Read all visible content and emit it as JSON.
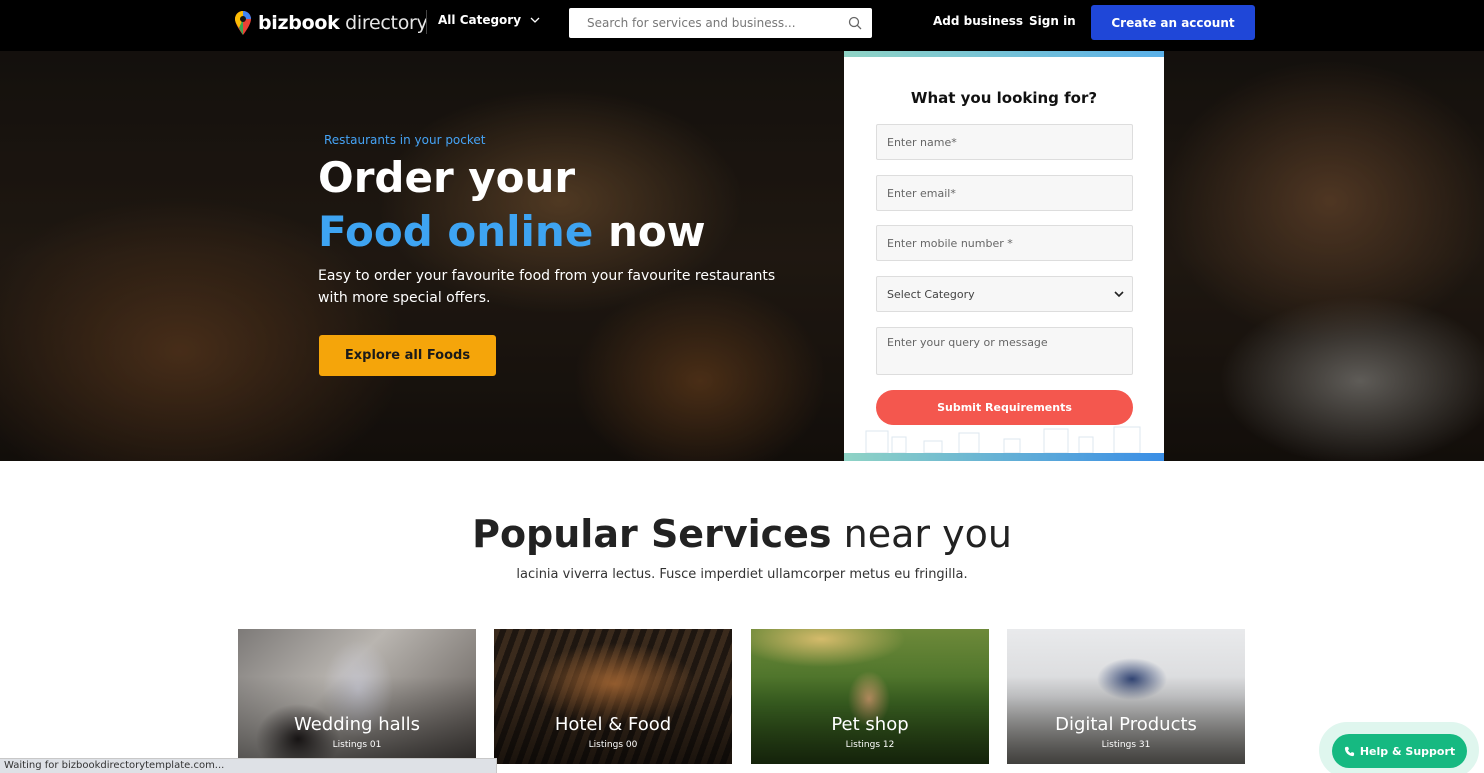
{
  "header": {
    "logo_bold": "bizbook",
    "logo_light": "directory",
    "category_label": "All Category",
    "search_placeholder": "Search for services and business...",
    "add_business": "Add business",
    "sign_in": "Sign in",
    "create_account": "Create an account"
  },
  "hero": {
    "tagline": "Restaurants in your pocket",
    "headline_line1": "Order your",
    "headline_highlight": "Food online",
    "headline_end": " now",
    "description": "Easy to order your favourite food from your favourite restaurants with more special offers.",
    "cta": "Explore all Foods"
  },
  "form": {
    "title": "What you looking for?",
    "name_placeholder": "Enter name*",
    "email_placeholder": "Enter email*",
    "mobile_placeholder": "Enter mobile number *",
    "category_selected": "Select Category",
    "message_placeholder": "Enter your query or message",
    "submit": "Submit Requirements"
  },
  "popular": {
    "title_bold": "Popular Services",
    "title_light": " near you",
    "subtitle": "lacinia viverra lectus. Fusce imperdiet ullamcorper metus eu fringilla.",
    "cards": [
      {
        "title": "Wedding halls",
        "count": "Listings 01"
      },
      {
        "title": "Hotel & Food",
        "count": "Listings 00"
      },
      {
        "title": "Pet shop",
        "count": "Listings 12"
      },
      {
        "title": "Digital Products",
        "count": "Listings 31"
      }
    ]
  },
  "help": {
    "label": "Help & Support"
  },
  "status": {
    "text": "Waiting for bizbookdirectorytemplate.com..."
  },
  "colors": {
    "brand_blue": "#1f47d8",
    "headline_blue": "#3ea4f2",
    "cta_orange": "#f5a50a",
    "submit_red": "#f4574e",
    "help_green": "#16b981"
  }
}
